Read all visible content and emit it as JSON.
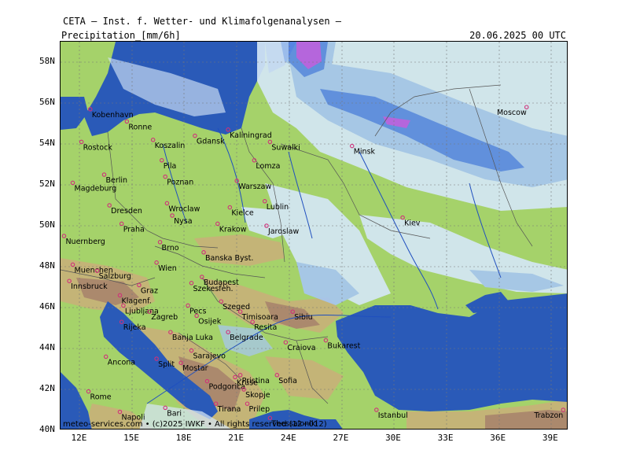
{
  "header": {
    "title": "CETA — Inst. f. Wetter- und Klimafolgenanalysen —",
    "parameter": "Precipitation_[mm/6h]",
    "datetime": "20.06.2025 00 UTC"
  },
  "axes": {
    "lat_ticks": [
      "58N",
      "56N",
      "54N",
      "52N",
      "50N",
      "48N",
      "46N",
      "44N",
      "42N",
      "40N"
    ],
    "lon_ticks": [
      "12E",
      "15E",
      "18E",
      "21E",
      "24E",
      "27E",
      "30E",
      "33E",
      "36E",
      "39E"
    ]
  },
  "cities": [
    {
      "name": "Kobenhavn",
      "lon": 12.6,
      "lat": 55.7
    },
    {
      "name": "Ronne",
      "lon": 14.7,
      "lat": 55.1
    },
    {
      "name": "Rostock",
      "lon": 12.1,
      "lat": 54.1
    },
    {
      "name": "Koszalin",
      "lon": 16.2,
      "lat": 54.2
    },
    {
      "name": "Gdansk",
      "lon": 18.6,
      "lat": 54.4
    },
    {
      "name": "Kaliningrad",
      "lon": 20.5,
      "lat": 54.7
    },
    {
      "name": "Suwalki",
      "lon": 22.9,
      "lat": 54.1
    },
    {
      "name": "Minsk",
      "lon": 27.6,
      "lat": 53.9
    },
    {
      "name": "Moscow",
      "lon": 37.6,
      "lat": 55.8
    },
    {
      "name": "Pila",
      "lon": 16.7,
      "lat": 53.2
    },
    {
      "name": "Lomza",
      "lon": 22.0,
      "lat": 53.2
    },
    {
      "name": "Berlin",
      "lon": 13.4,
      "lat": 52.5
    },
    {
      "name": "Magdeburg",
      "lon": 11.6,
      "lat": 52.1
    },
    {
      "name": "Poznan",
      "lon": 16.9,
      "lat": 52.4
    },
    {
      "name": "Warszaw",
      "lon": 21.0,
      "lat": 52.2
    },
    {
      "name": "Dresden",
      "lon": 13.7,
      "lat": 51.0
    },
    {
      "name": "Wroclaw",
      "lon": 17.0,
      "lat": 51.1
    },
    {
      "name": "Lublin",
      "lon": 22.6,
      "lat": 51.2
    },
    {
      "name": "Kielce",
      "lon": 20.6,
      "lat": 50.9
    },
    {
      "name": "Kiev",
      "lon": 30.5,
      "lat": 50.4
    },
    {
      "name": "Nysa",
      "lon": 17.3,
      "lat": 50.5
    },
    {
      "name": "Praha",
      "lon": 14.4,
      "lat": 50.1
    },
    {
      "name": "Krakow",
      "lon": 19.9,
      "lat": 50.1
    },
    {
      "name": "Jaroslaw",
      "lon": 22.7,
      "lat": 50.0
    },
    {
      "name": "Nuernberg",
      "lon": 11.1,
      "lat": 49.5
    },
    {
      "name": "Brno",
      "lon": 16.6,
      "lat": 49.2
    },
    {
      "name": "Banska Byst.",
      "lon": 19.1,
      "lat": 48.7
    },
    {
      "name": "Muenchen",
      "lon": 11.6,
      "lat": 48.1
    },
    {
      "name": "Wien",
      "lon": 16.4,
      "lat": 48.2
    },
    {
      "name": "Salzburg",
      "lon": 13.0,
      "lat": 47.8
    },
    {
      "name": "Innsbruck",
      "lon": 11.4,
      "lat": 47.3
    },
    {
      "name": "Budapest",
      "lon": 19.0,
      "lat": 47.5
    },
    {
      "name": "Szekesfeh.",
      "lon": 18.4,
      "lat": 47.2
    },
    {
      "name": "Graz",
      "lon": 15.4,
      "lat": 47.1
    },
    {
      "name": "Klagenf.",
      "lon": 14.3,
      "lat": 46.6
    },
    {
      "name": "Szeged",
      "lon": 20.1,
      "lat": 46.3
    },
    {
      "name": "Ljubljana",
      "lon": 14.5,
      "lat": 46.1
    },
    {
      "name": "Pecs",
      "lon": 18.2,
      "lat": 46.1
    },
    {
      "name": "Sibiu",
      "lon": 24.2,
      "lat": 45.8
    },
    {
      "name": "Zagreb",
      "lon": 16.0,
      "lat": 45.8
    },
    {
      "name": "Osijek",
      "lon": 18.7,
      "lat": 45.6
    },
    {
      "name": "Timisoara",
      "lon": 21.2,
      "lat": 45.8
    },
    {
      "name": "Rijeka",
      "lon": 14.4,
      "lat": 45.3
    },
    {
      "name": "Resita",
      "lon": 21.9,
      "lat": 45.3
    },
    {
      "name": "Banja Luka",
      "lon": 17.2,
      "lat": 44.8
    },
    {
      "name": "Belgrade",
      "lon": 20.5,
      "lat": 44.8
    },
    {
      "name": "Bukarest",
      "lon": 26.1,
      "lat": 44.4
    },
    {
      "name": "Craiova",
      "lon": 23.8,
      "lat": 44.3
    },
    {
      "name": "Split",
      "lon": 16.4,
      "lat": 43.5
    },
    {
      "name": "Sarajevo",
      "lon": 18.4,
      "lat": 43.9
    },
    {
      "name": "Ancona",
      "lon": 13.5,
      "lat": 43.6
    },
    {
      "name": "Mostar",
      "lon": 17.8,
      "lat": 43.3
    },
    {
      "name": "Sofia",
      "lon": 23.3,
      "lat": 42.7
    },
    {
      "name": "Pristina",
      "lon": 21.2,
      "lat": 42.7
    },
    {
      "name": "Kruse",
      "lon": 20.9,
      "lat": 42.6
    },
    {
      "name": "Podgorica",
      "lon": 19.3,
      "lat": 42.4
    },
    {
      "name": "Skopje",
      "lon": 21.4,
      "lat": 42.0
    },
    {
      "name": "Rome",
      "lon": 12.5,
      "lat": 41.9
    },
    {
      "name": "Tirana",
      "lon": 19.8,
      "lat": 41.3
    },
    {
      "name": "Prilep",
      "lon": 21.6,
      "lat": 41.3
    },
    {
      "name": "Thessaloniki",
      "lon": 22.9,
      "lat": 40.6
    },
    {
      "name": "Napoli",
      "lon": 14.3,
      "lat": 40.9
    },
    {
      "name": "Bari",
      "lon": 16.9,
      "lat": 41.1
    },
    {
      "name": "Istanbul",
      "lon": 29.0,
      "lat": 41.0
    },
    {
      "name": "Trabzon",
      "lon": 39.7,
      "lat": 41.0
    }
  ],
  "footer": {
    "credit": "meteo-services.com • (c)2025 IWKF • All rights reserved (12+012)"
  },
  "colors": {
    "sea": "#2a5ab8",
    "land_low": "#a5d26a",
    "land_mid": "#c4b477",
    "land_high": "#ab896d",
    "precip_light": "#d4e6f6",
    "precip_mid": "#a6c6f0",
    "precip_heavy": "#5b8ae6",
    "precip_extreme": "#b65ce6",
    "city_marker": "#d0307a"
  }
}
